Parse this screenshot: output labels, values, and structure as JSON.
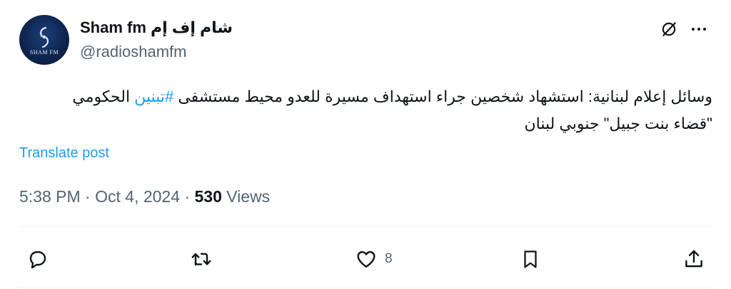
{
  "account": {
    "display_name": "Sham fm شام إف إم",
    "handle": "@radioshamfm",
    "avatar_text": "SHAM FM"
  },
  "post": {
    "text_before": "وسائل إعلام لبنانية: استشهاد شخصين جراء استهداف مسيرة للعدو محيط مستشفى ",
    "hashtag": "#تبنين",
    "text_after": " الحكومي \"قضاء بنت جبيل\" جنوبي لبنان",
    "translate_label": "Translate post"
  },
  "meta": {
    "time": "5:38 PM",
    "separator": "·",
    "date": "Oct 4, 2024",
    "views_count": "530",
    "views_label": "Views"
  },
  "actions": {
    "like_count": "8"
  },
  "icons": {
    "grok": "grok-icon",
    "more": "more-icon",
    "reply": "reply-icon",
    "retweet": "retweet-icon",
    "like": "heart-icon",
    "bookmark": "bookmark-icon",
    "share": "share-icon"
  },
  "colors": {
    "link": "#1d9bf0",
    "secondary": "#536471",
    "primary": "#0f1419"
  }
}
